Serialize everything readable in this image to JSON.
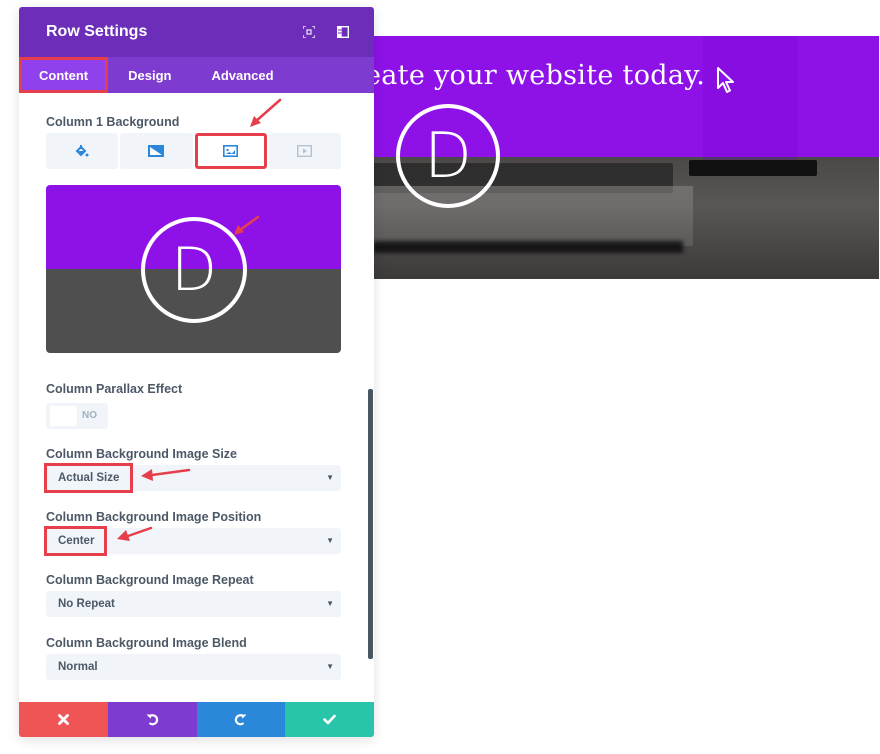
{
  "modal": {
    "title": "Row Settings",
    "header_icons": [
      "fullscreen-icon",
      "sidebar-layout-icon"
    ],
    "tabs": [
      {
        "label": "Content",
        "active": true,
        "highlighted": true
      },
      {
        "label": "Design",
        "active": false
      },
      {
        "label": "Advanced",
        "active": false
      }
    ]
  },
  "fields": {
    "background_label": "Column 1 Background",
    "background_types": [
      {
        "icon": "paint-bucket-icon",
        "name": "color"
      },
      {
        "icon": "gradient-icon",
        "name": "gradient"
      },
      {
        "icon": "image-icon",
        "name": "image",
        "active": true,
        "highlighted": true
      },
      {
        "icon": "video-icon",
        "name": "video"
      }
    ],
    "image_preview_letter": "D",
    "parallax": {
      "label": "Column Parallax Effect",
      "value": "NO"
    },
    "image_size": {
      "label": "Column Background Image Size",
      "value": "Actual Size",
      "highlighted": true
    },
    "image_position": {
      "label": "Column Background Image Position",
      "value": "Center",
      "highlighted": true
    },
    "image_repeat": {
      "label": "Column Background Image Repeat",
      "value": "No Repeat"
    },
    "image_blend": {
      "label": "Column Background Image Blend",
      "value": "Normal"
    },
    "caret": "▼"
  },
  "footer": {
    "buttons": [
      {
        "name": "discard",
        "icon": "close-icon",
        "color": "#ef5555"
      },
      {
        "name": "undo",
        "icon": "undo-icon",
        "color": "#7e3bd0"
      },
      {
        "name": "redo",
        "icon": "redo-icon",
        "color": "#2b87da"
      },
      {
        "name": "save",
        "icon": "check-icon",
        "color": "#29c4a9"
      }
    ]
  },
  "preview": {
    "headline": "eate your website today.",
    "logo_letter": "D"
  },
  "colors": {
    "header_purple": "#6c2eb9",
    "tabs_purple": "#7e3bd0",
    "active_tab": "#8f42ec",
    "highlight_red": "#e63f4b",
    "preview_purple": "#8e12e8",
    "icon_blue": "#2b87da"
  }
}
